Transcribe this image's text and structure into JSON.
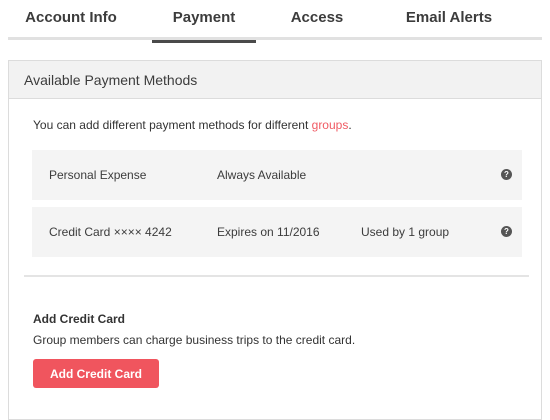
{
  "tabs": [
    {
      "label": "Account Info",
      "active": false
    },
    {
      "label": "Payment",
      "active": true
    },
    {
      "label": "Access",
      "active": false
    },
    {
      "label": "Email Alerts",
      "active": false
    }
  ],
  "panel": {
    "title": "Available Payment Methods",
    "intro_text": "You can add different payment methods for different ",
    "intro_link": "groups",
    "intro_suffix": "."
  },
  "payment_methods": [
    {
      "name": "Personal Expense",
      "status": "Always Available",
      "usage": "",
      "help_icon": "question-circle-icon"
    },
    {
      "name": "Credit Card ×××× 4242",
      "status": "Expires on 11/2016",
      "usage": "Used by 1 group",
      "help_icon": "question-circle-icon"
    }
  ],
  "add_card": {
    "title": "Add Credit Card",
    "description": "Group members can charge business trips to the credit card.",
    "button_label": "Add Credit Card"
  },
  "colors": {
    "accent": "#f0555e",
    "link": "#f05a63",
    "row_background": "#f4f4f4",
    "header_background": "#f2f2f2"
  }
}
